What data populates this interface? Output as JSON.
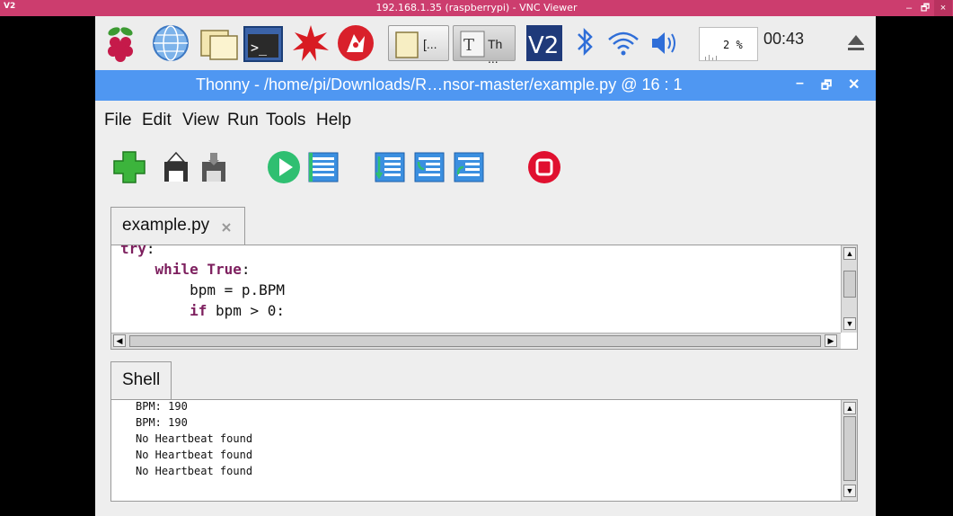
{
  "vnc": {
    "logo": "V2",
    "title": "192.168.1.35 (raspberrypi) - VNC Viewer",
    "minimize": "–",
    "maximize": "🗗",
    "close": "×"
  },
  "panel": {
    "tasks": [
      "[...",
      "Th ..."
    ],
    "cpu_percent": "2 %",
    "clock": "00:43"
  },
  "window": {
    "title": "Thonny  -  /home/pi/Downloads/R…nsor-master/example.py  @  16 : 1",
    "minimize": "–",
    "maximize": "🗗",
    "close": "✕"
  },
  "menu": [
    "File",
    "Edit",
    "View",
    "Run",
    "Tools",
    "Help"
  ],
  "toolbar": [
    "new",
    "load",
    "save",
    "run",
    "debug",
    "step-over",
    "step-into",
    "step-out",
    "stop"
  ],
  "editor": {
    "tab_label": "example.py",
    "lines": [
      {
        "kw": "try",
        "rest": ":"
      },
      {
        "indent": "    ",
        "kw": "while True",
        "rest": ":"
      },
      {
        "indent": "        ",
        "kw": "",
        "rest": "bpm = p.BPM"
      },
      {
        "indent": "        ",
        "kw": "if",
        "rest": " bpm > 0:"
      }
    ]
  },
  "shell": {
    "tab_label": "Shell",
    "output": [
      "BPM: 190",
      "BPM: 190",
      "No Heartbeat found",
      "No Heartbeat found",
      "No Heartbeat found"
    ]
  },
  "colors": {
    "vnc_bar": "#cc3d6e",
    "title_bar": "#4f97f2",
    "keyword": "#7d1f5e",
    "new_green": "#3cb43c",
    "run_green": "#2fbf71",
    "stop_red": "#e0102f"
  }
}
